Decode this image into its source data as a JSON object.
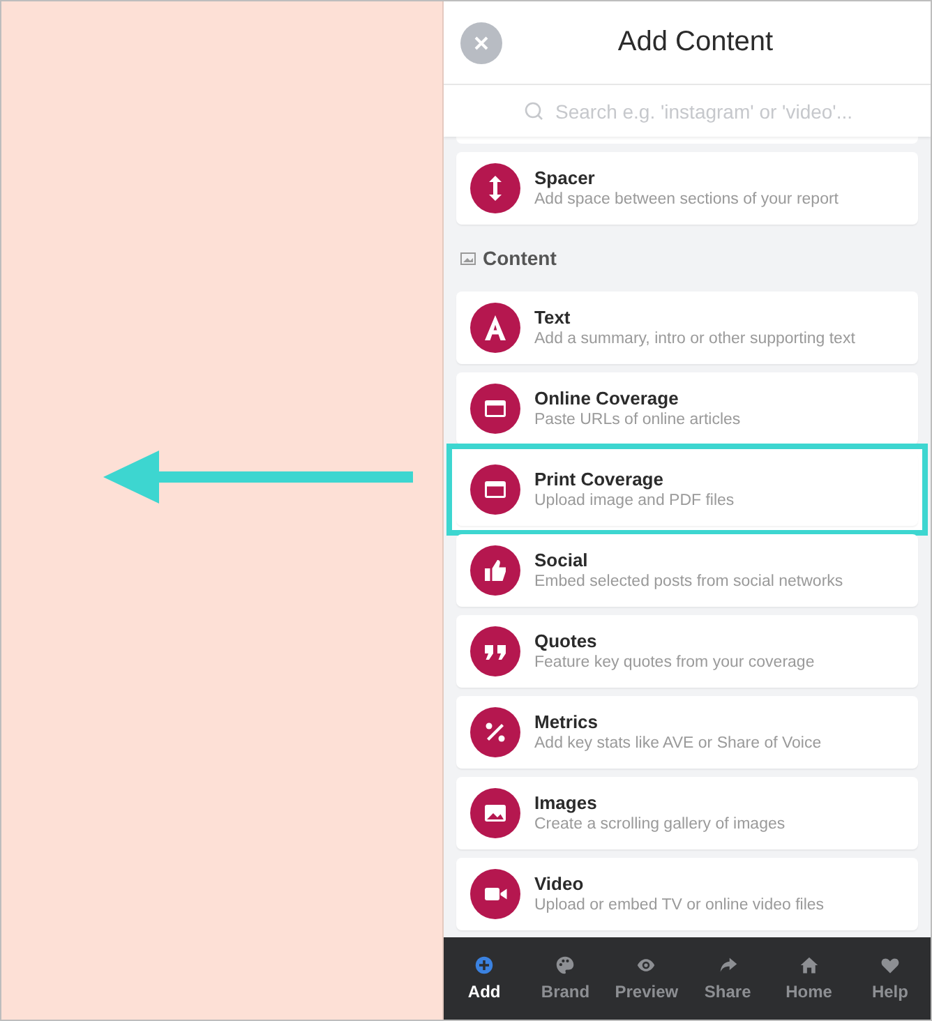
{
  "panel": {
    "title": "Add Content",
    "search": {
      "placeholder": "Search e.g. 'instagram' or 'video'..."
    }
  },
  "top_items": [
    {
      "title": "Spacer",
      "description": "Add space between sections of your report",
      "highlighted": false
    }
  ],
  "section": {
    "label": "Content"
  },
  "items": [
    {
      "title": "Text",
      "description": "Add a summary, intro or other supporting text",
      "highlighted": false
    },
    {
      "title": "Online Coverage",
      "description": "Paste URLs of online articles",
      "highlighted": false
    },
    {
      "title": "Print Coverage",
      "description": "Upload image and PDF files",
      "highlighted": true
    },
    {
      "title": "Social",
      "description": "Embed selected posts from social networks",
      "highlighted": false
    },
    {
      "title": "Quotes",
      "description": "Feature key quotes from your coverage",
      "highlighted": false
    },
    {
      "title": "Metrics",
      "description": "Add key stats like AVE or Share of Voice",
      "highlighted": false
    },
    {
      "title": "Images",
      "description": "Create a scrolling gallery of images",
      "highlighted": false
    },
    {
      "title": "Video",
      "description": "Upload or embed TV or online video files",
      "highlighted": false
    }
  ],
  "bottom_nav": [
    {
      "label": "Add",
      "selected": true
    },
    {
      "label": "Brand",
      "selected": false
    },
    {
      "label": "Preview",
      "selected": false
    },
    {
      "label": "Share",
      "selected": false
    },
    {
      "label": "Home",
      "selected": false
    },
    {
      "label": "Help",
      "selected": false
    }
  ]
}
